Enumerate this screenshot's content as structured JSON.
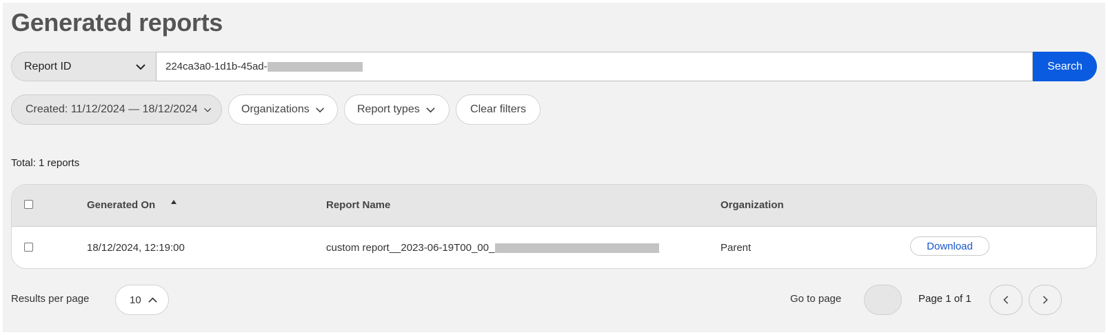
{
  "page": {
    "title": "Generated reports"
  },
  "search": {
    "field_label": "Report ID",
    "value": "224ca3a0-1d1b-45ad-",
    "button_label": "Search"
  },
  "filters": {
    "created_label": "Created: 11/12/2024 — 18/12/2024",
    "organizations_label": "Organizations",
    "report_types_label": "Report types",
    "clear_label": "Clear filters"
  },
  "summary": {
    "total_label": "Total: 1 reports"
  },
  "table": {
    "columns": {
      "generated_on": "Generated On",
      "report_name": "Report Name",
      "organization": "Organization"
    },
    "rows": [
      {
        "generated_on": "18/12/2024, 12:19:00",
        "report_name": "custom report__2023-06-19T00_00_",
        "organization": "Parent",
        "action_label": "Download"
      }
    ]
  },
  "pagination": {
    "results_per_page_label": "Results per page",
    "results_per_page_value": "10",
    "go_to_page_label": "Go to page",
    "page_info": "Page 1 of 1"
  },
  "colors": {
    "primary": "#0b5be0",
    "link": "#1a56c8",
    "background": "#f2f2f2"
  },
  "icons": {
    "field_dropdown": "chevron-down-icon",
    "sort": "sort-ascending-icon",
    "rpp_dropdown": "chevron-up-icon",
    "prev": "chevron-left-icon",
    "next": "chevron-right-icon"
  }
}
